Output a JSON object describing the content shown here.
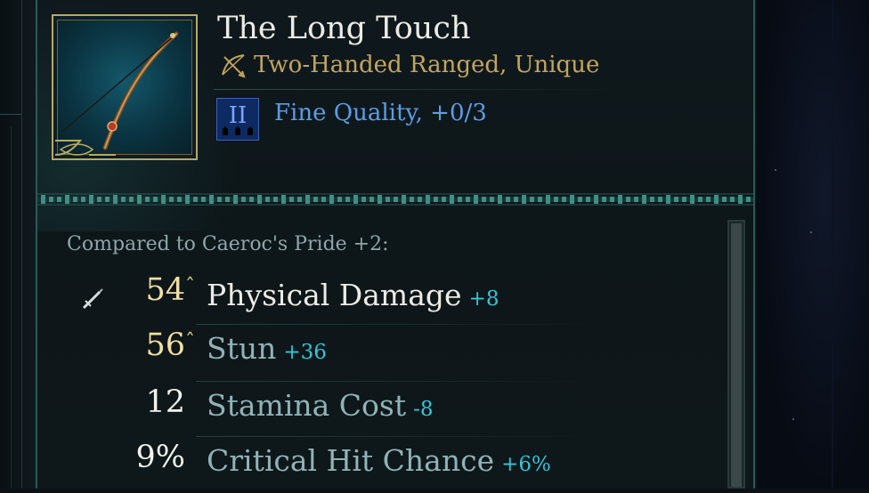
{
  "item": {
    "name": "The Long Touch",
    "type": "Two-Handed Ranged, Unique",
    "quality_badge": "II",
    "quality_text": "Fine Quality, +0/3",
    "icon": "bow-icon"
  },
  "comparison": {
    "header": "Compared to Caeroc's Pride +2:",
    "stats": [
      {
        "value": "54",
        "label": "Physical Damage",
        "delta": "+8",
        "caret": "ˆ"
      },
      {
        "value": "56",
        "label": "Stun",
        "delta": "+36",
        "caret": "ˆ"
      },
      {
        "value": "12",
        "label": "Stamina Cost",
        "delta": "-8"
      },
      {
        "value": "9%",
        "label": "Critical Hit Chance",
        "delta": "+6%"
      }
    ]
  },
  "colors": {
    "title": "#ecebe4",
    "unique_gold": "#c4a55b",
    "quality_blue": "#5b9de8",
    "value_gold": "#f0dfa0",
    "value_white": "#f2f2ee",
    "label_white": "#ecebe4",
    "label_teal": "#8fb3b7",
    "delta_cyan": "#33c6d6"
  }
}
